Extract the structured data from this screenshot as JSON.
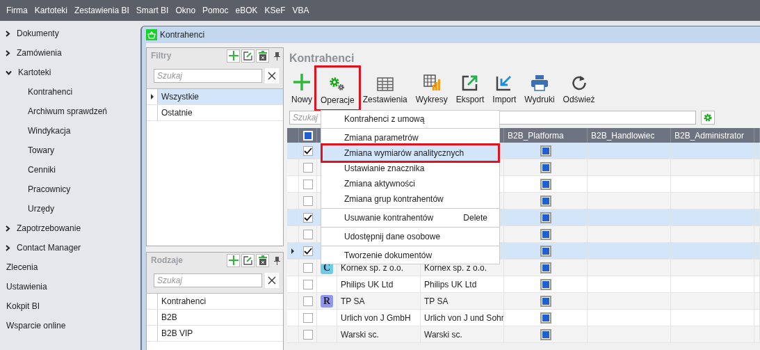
{
  "menu_bar": [
    "Firma",
    "Kartoteki",
    "Zestawienia BI",
    "Smart BI",
    "Okno",
    "Pomoc",
    "eBOK",
    "KSeF",
    "VBA"
  ],
  "sidebar": {
    "items": [
      {
        "label": "Dokumenty",
        "kind": "group",
        "expanded": false
      },
      {
        "label": "Zamówienia",
        "kind": "group",
        "expanded": false
      },
      {
        "label": "Kartoteki",
        "kind": "group",
        "expanded": true,
        "children": [
          {
            "label": "Kontrahenci"
          },
          {
            "label": "Archiwum sprawdzeń"
          },
          {
            "label": "Windykacja"
          },
          {
            "label": "Towary"
          },
          {
            "label": "Cenniki"
          },
          {
            "label": "Pracownicy"
          },
          {
            "label": "Urzędy"
          }
        ]
      },
      {
        "label": "Zapotrzebowanie",
        "kind": "group",
        "expanded": false
      },
      {
        "label": "Contact Manager",
        "kind": "group",
        "expanded": false
      },
      {
        "label": "Zlecenia",
        "kind": "link"
      },
      {
        "label": "Ustawienia",
        "kind": "link"
      },
      {
        "label": "Kokpit BI",
        "kind": "link"
      },
      {
        "label": "Wsparcie online",
        "kind": "link"
      }
    ]
  },
  "window": {
    "title": "Kontrahenci"
  },
  "filters_panel": {
    "title": "Filtry",
    "search": {
      "placeholder": "Szukaj"
    },
    "items": [
      {
        "label": "Wszystkie",
        "selected": true
      },
      {
        "label": "Ostatnie",
        "selected": false
      }
    ]
  },
  "kinds_panel": {
    "title": "Rodzaje",
    "search": {
      "placeholder": "Szukaj"
    },
    "items": [
      {
        "label": "Kontrahenci",
        "selected": false
      },
      {
        "label": "B2B",
        "selected": false
      },
      {
        "label": "B2B VIP",
        "selected": false
      }
    ]
  },
  "main": {
    "title": "Kontrahenci",
    "toolbar": [
      {
        "label": "Nowy",
        "kind": "new",
        "annotated": false
      },
      {
        "label": "Operacje",
        "kind": "operations",
        "annotated": true
      },
      {
        "label": "Zestawienia",
        "kind": "table",
        "annotated": false
      },
      {
        "label": "Wykresy",
        "kind": "chart",
        "annotated": false
      },
      {
        "label": "Eksport",
        "kind": "export",
        "annotated": false
      },
      {
        "label": "Import",
        "kind": "import",
        "annotated": false
      },
      {
        "label": "Wydruki",
        "kind": "print",
        "annotated": false
      },
      {
        "label": "Odśwież",
        "kind": "refresh",
        "annotated": false
      }
    ],
    "search": {
      "placeholder": "Szukaj"
    },
    "table": {
      "select_all_checked": true,
      "columns": [
        "B2B_Platforma",
        "B2B_Handlowiec",
        "B2B_Administrator"
      ],
      "rows": [
        {
          "checked": true,
          "selected": true,
          "current": false,
          "b2b_platforma": true
        },
        {
          "checked": false,
          "selected": false,
          "current": false,
          "b2b_platforma": true
        },
        {
          "checked": false,
          "selected": false,
          "current": false,
          "b2b_platforma": true
        },
        {
          "checked": false,
          "selected": false,
          "current": false,
          "b2b_platforma": true
        },
        {
          "checked": true,
          "selected": true,
          "current": false,
          "b2b_platforma": true
        },
        {
          "checked": false,
          "selected": false,
          "current": false,
          "b2b_platforma": true
        },
        {
          "checked": true,
          "selected": true,
          "current": true,
          "b2b_platforma": true
        },
        {
          "checked": false,
          "selected": false,
          "current": false,
          "badge": {
            "letter": "C",
            "color": "#6dcde8"
          },
          "name": "Kornex sp. z o.o.",
          "full_name": "Kornex sp. z o.o.",
          "b2b_platforma": true
        },
        {
          "checked": false,
          "selected": false,
          "current": false,
          "name": "Philips UK Ltd",
          "full_name": "Philips UK Ltd",
          "b2b_platforma": true
        },
        {
          "checked": false,
          "selected": false,
          "current": false,
          "badge": {
            "letter": "R",
            "color": "#8e96f0"
          },
          "name": "TP SA",
          "full_name": "TP SA",
          "b2b_platforma": true
        },
        {
          "checked": false,
          "selected": false,
          "current": false,
          "name": "Urlich von J GmbH",
          "full_name": "Urlich von J und Sohr",
          "b2b_platforma": true
        },
        {
          "checked": false,
          "selected": false,
          "current": false,
          "name": "Warski sc.",
          "full_name": "Warski sc.",
          "b2b_platforma": true
        }
      ]
    }
  },
  "context_menu": {
    "items": [
      {
        "kind": "item",
        "label": "Kontrahenci z umową",
        "selected": false,
        "annotated": false
      },
      {
        "kind": "separator"
      },
      {
        "kind": "item",
        "label": "Zmiana parametrów",
        "selected": false,
        "annotated": false
      },
      {
        "kind": "item",
        "label": "Zmiana wymiarów analitycznych",
        "selected": true,
        "annotated": true
      },
      {
        "kind": "item",
        "label": "Ustawianie znacznika",
        "selected": false,
        "annotated": false
      },
      {
        "kind": "item",
        "label": "Zmiana aktywności",
        "selected": false,
        "annotated": false
      },
      {
        "kind": "item",
        "label": "Zmiana grup kontrahentów",
        "selected": false,
        "annotated": false
      },
      {
        "kind": "separator"
      },
      {
        "kind": "item",
        "label": "Usuwanie kontrahentów",
        "shortcut": "Delete",
        "selected": false,
        "annotated": false
      },
      {
        "kind": "separator"
      },
      {
        "kind": "item",
        "label": "Udostępnij dane osobowe",
        "selected": false,
        "annotated": false
      },
      {
        "kind": "separator"
      },
      {
        "kind": "item",
        "label": "Tworzenie dokumentów",
        "selected": false,
        "annotated": false
      }
    ]
  }
}
